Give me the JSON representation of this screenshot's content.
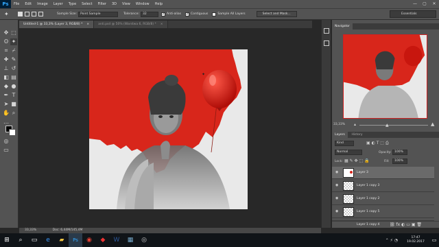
{
  "app": {
    "logo": "Ps",
    "menu": [
      "File",
      "Edit",
      "Image",
      "Layer",
      "Type",
      "Select",
      "Filter",
      "3D",
      "View",
      "Window",
      "Help"
    ],
    "window_controls": [
      "—",
      "▢",
      "✕"
    ]
  },
  "options": {
    "sample_size_label": "Sample Size:",
    "sample_size_value": "Point Sample",
    "tolerance_label": "Tolerance:",
    "tolerance_value": "32",
    "anti_alias_label": "Anti-alias",
    "contiguous_label": "Contiguous",
    "sample_all_label": "Sample All Layers",
    "select_mask_label": "Select and Mask...",
    "workspace": "Essentials"
  },
  "tabs": [
    {
      "label": "Untitled-1 @ 33,3% (Layer 3, RGB/8) *",
      "close": "×",
      "active": true
    },
    {
      "label": "anti.psd @ 50% (Warstwa 6, RGB/8) *",
      "close": "×",
      "active": false
    }
  ],
  "status": {
    "zoom": "33,33%",
    "doc": "Doc: 6,44M/145,4M"
  },
  "navigator": {
    "tab": "Navigator",
    "zoom": "33,33%"
  },
  "layers_panel": {
    "tab_layers": "Layers",
    "tab_history": "History",
    "kind": "Kind",
    "blend_mode": "Normal",
    "opacity_label": "Opacity:",
    "opacity_value": "100%",
    "lock_label": "Lock:",
    "fill_label": "Fill:",
    "fill_value": "100%",
    "items": [
      {
        "name": "Layer 3"
      },
      {
        "name": "Layer 1 copy 3"
      },
      {
        "name": "Layer 1 copy 2"
      },
      {
        "name": "Layer 1 copy 5"
      },
      {
        "name": "Layer 1 copy 4"
      }
    ]
  },
  "taskbar": {
    "time": "17:47",
    "date": "19.02.2017"
  },
  "colors": {
    "accent_red": "#d8261b",
    "panel": "#535353",
    "bg": "#282828"
  },
  "icons": [
    "move-icon",
    "marquee-icon",
    "lasso-icon",
    "magic-wand-icon",
    "crop-icon",
    "eyedropper-icon",
    "healing-icon",
    "brush-icon",
    "stamp-icon",
    "history-brush-icon",
    "eraser-icon",
    "gradient-icon",
    "blur-icon",
    "dodge-icon",
    "pen-icon",
    "type-icon",
    "path-select-icon",
    "shape-icon",
    "hand-icon",
    "zoom-icon"
  ]
}
